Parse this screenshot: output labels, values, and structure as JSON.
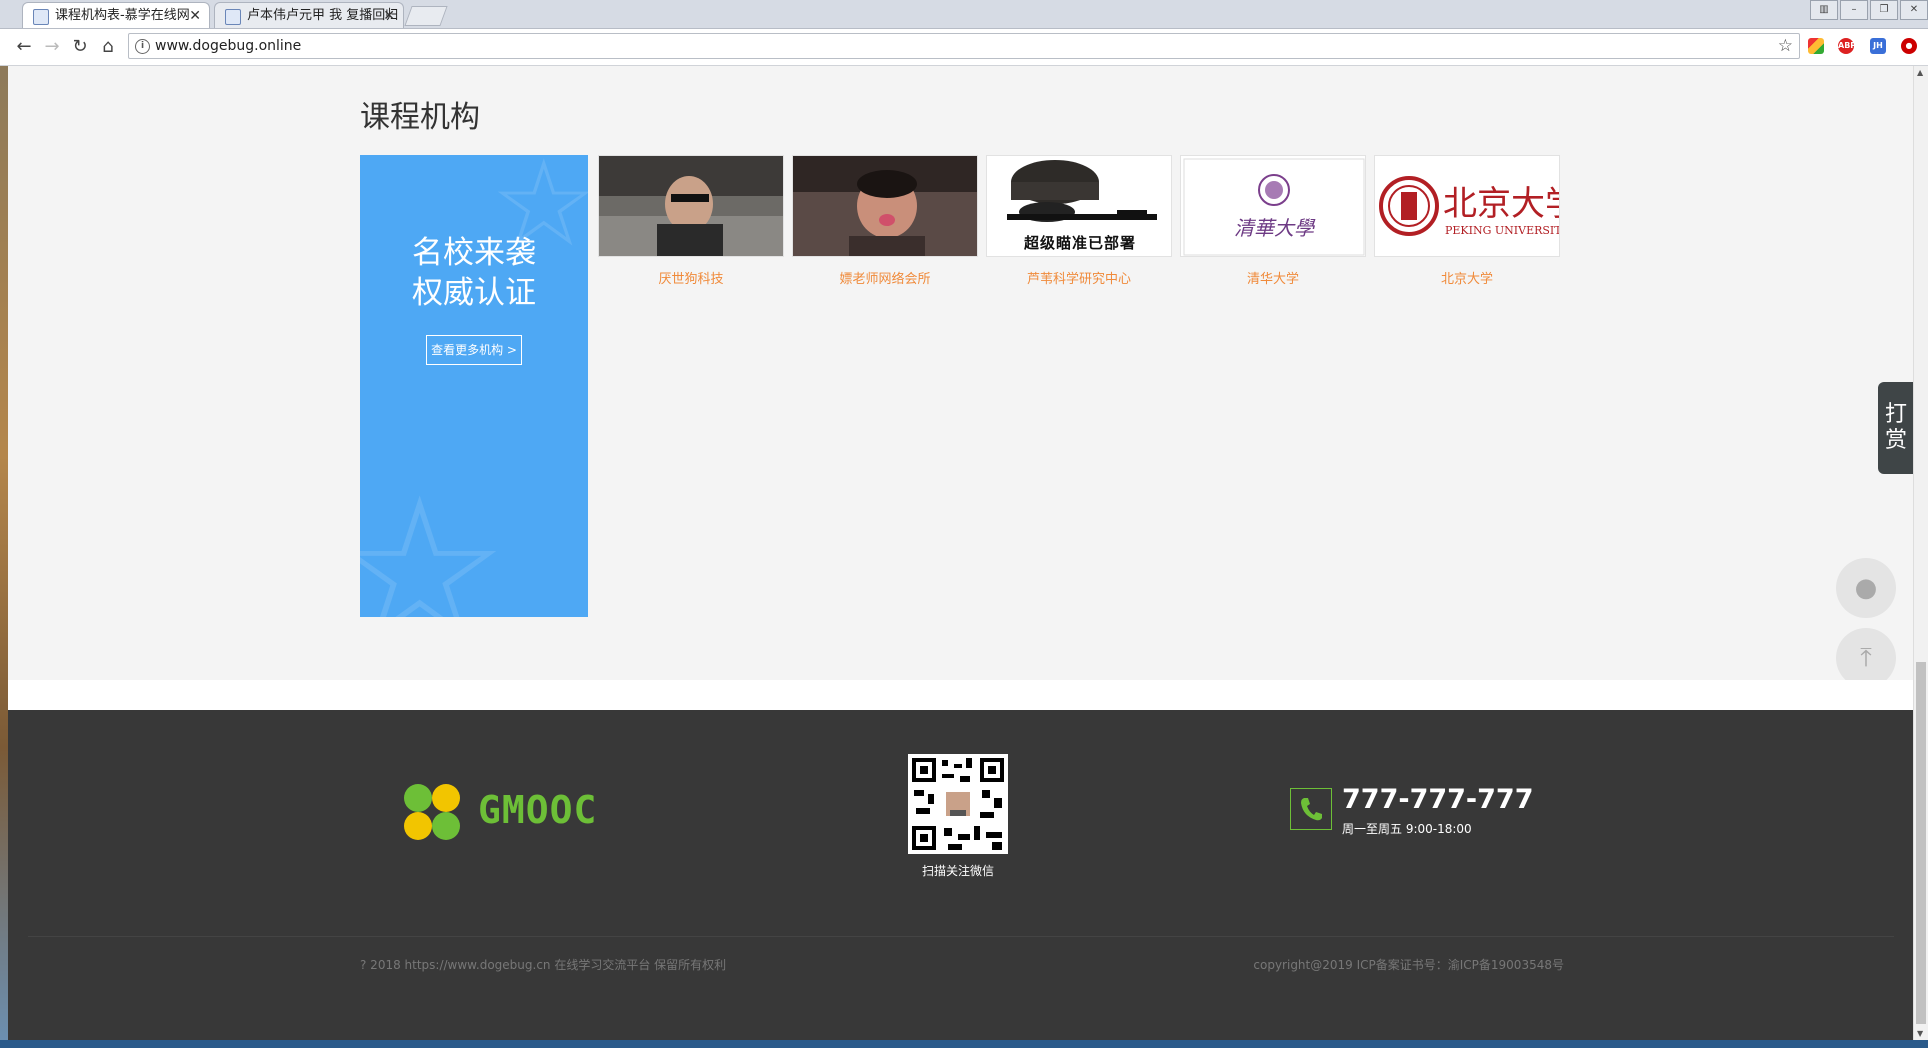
{
  "browser": {
    "tabs": [
      {
        "title": "课程机构表-慕学在线网"
      },
      {
        "title": "卢本伟卢元甲 我 复播回归"
      }
    ],
    "url": "www.dogebug.online",
    "extensions": [
      "ABP",
      "JH"
    ]
  },
  "section": {
    "title": "课程机构"
  },
  "promo": {
    "line1": "名校来袭",
    "line2": "权威认证",
    "button": "查看更多机构 >"
  },
  "orgs": [
    {
      "name": "厌世狗科技"
    },
    {
      "name": "嫖老师网络会所"
    },
    {
      "name": "芦苇科学研究中心",
      "logo_text": "超级瞄准已部署"
    },
    {
      "name": "清华大学",
      "logo_text": "清華大學"
    },
    {
      "name": "北京大学",
      "logo_text": "北京大学",
      "logo_sub": "PEKING UNIVERSITY"
    }
  ],
  "footer": {
    "brand": "GMOOC",
    "qr_caption": "扫描关注微信",
    "phone": "777-777-777",
    "hours": "周一至周五 9:00-18:00",
    "copyright_left": "? 2018 https://www.dogebug.cn 在线学习交流平台 保留所有权利",
    "copyright_right": "copyright@2019 ICP备案证书号：渝ICP备19003548号"
  },
  "side": {
    "reward_label": "打赏"
  },
  "colors": {
    "promo_bg": "#4ea8f4",
    "org_name": "#f08a3a",
    "footer_bg": "#383838",
    "brand_green": "#6dbf37"
  }
}
